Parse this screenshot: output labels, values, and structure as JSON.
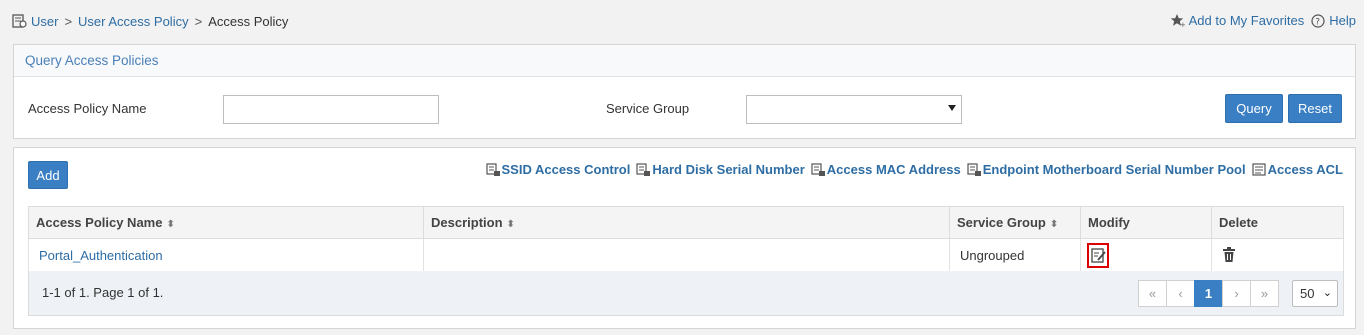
{
  "breadcrumb": {
    "items": [
      "User",
      "User Access Policy"
    ],
    "separator": ">",
    "current": "Access Policy"
  },
  "top_links": {
    "favorites": "Add to My Favorites",
    "help": "Help"
  },
  "query_panel": {
    "title": "Query Access Policies",
    "policy_name_label": "Access Policy Name",
    "policy_name_value": "",
    "service_group_label": "Service Group",
    "service_group_value": "",
    "query_button": "Query",
    "reset_button": "Reset"
  },
  "list_panel": {
    "add_button": "Add",
    "links": [
      "SSID Access Control",
      "Hard Disk Serial Number",
      "Access MAC Address",
      "Endpoint Motherboard Serial Number Pool",
      "Access ACL"
    ],
    "columns": [
      "Access Policy Name",
      "Description",
      "Service Group",
      "Modify",
      "Delete"
    ],
    "rows": [
      {
        "name": "Portal_Authentication",
        "description": "",
        "service_group": "Ungrouped"
      }
    ],
    "summary": "1-1 of 1. Page 1 of 1.",
    "pager": {
      "first": "«",
      "prev": "‹",
      "current": "1",
      "next": "›",
      "last": "»"
    },
    "page_size": "50"
  },
  "colors": {
    "accent": "#3a7fc4",
    "link": "#2e6da4",
    "highlight": "#dd0000"
  }
}
